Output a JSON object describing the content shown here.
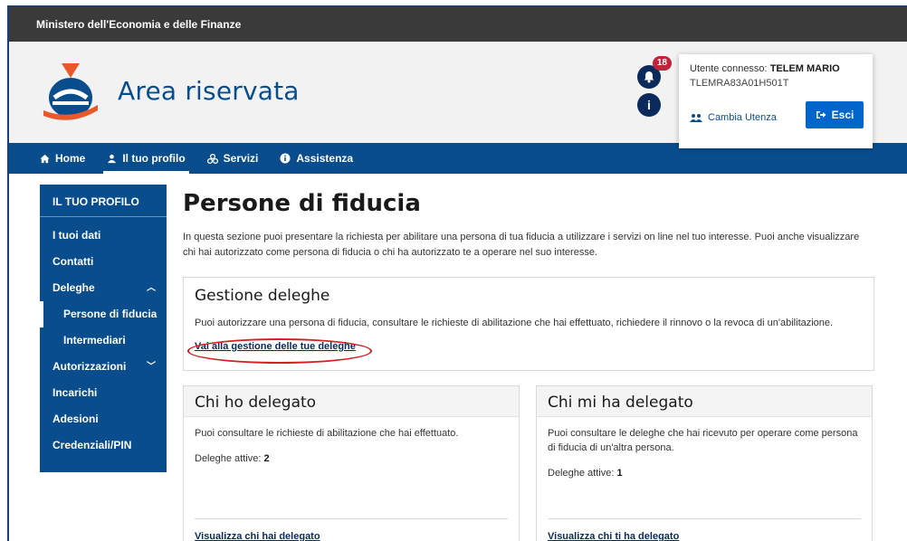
{
  "topbar": {
    "ministry": "Ministero dell'Economia e delle Finanze"
  },
  "header": {
    "title": "Area riservata",
    "notifications_count": "18",
    "user_label": "Utente connesso:",
    "user_name": "TELEM MARIO",
    "user_cf": "TLEMRA83A01H501T",
    "switch_user": "Cambia Utenza",
    "logout": "Esci"
  },
  "nav": {
    "items": [
      {
        "label": "Home",
        "icon": "home-icon"
      },
      {
        "label": "Il tuo profilo",
        "icon": "user-icon"
      },
      {
        "label": "Servizi",
        "icon": "services-icon"
      },
      {
        "label": "Assistenza",
        "icon": "info-icon"
      }
    ]
  },
  "sidebar": {
    "heading": "IL TUO PROFILO",
    "items": {
      "tuoi_dati": "I tuoi dati",
      "contatti": "Contatti",
      "deleghe": "Deleghe",
      "persone_fiducia": "Persone di fiducia",
      "intermediari": "Intermediari",
      "autorizzazioni": "Autorizzazioni",
      "incarichi": "Incarichi",
      "adesioni": "Adesioni",
      "credenziali": "Credenziali/PIN"
    }
  },
  "main": {
    "title": "Persone di fiducia",
    "intro": "In questa sezione puoi presentare la richiesta per abilitare una persona di tua fiducia a utilizzare i servizi on line nel tuo interesse. Puoi anche visualizzare chi hai autorizzato come persona di fiducia o chi ha autorizzato te a operare nel suo interesse.",
    "gestione": {
      "title": "Gestione deleghe",
      "text": "Puoi autorizzare una persona di fiducia, consultare le richieste di abilitazione che hai effettuato, richiedere il rinnovo o la revoca di un'abilitazione.",
      "link": "Vai alla gestione delle tue deleghe"
    },
    "chi_ho_delegato": {
      "title": "Chi ho delegato",
      "text": "Puoi consultare le richieste di abilitazione che hai effettuato.",
      "active_label": "Deleghe attive:",
      "active_value": "2",
      "link": "Visualizza chi hai delegato"
    },
    "chi_mi_ha_delegato": {
      "title": "Chi mi ha delegato",
      "text": "Puoi consultare le deleghe che hai ricevuto per operare come persona di fiducia di un'altra persona.",
      "active_label": "Deleghe attive:",
      "active_value": "1",
      "link": "Visualizza chi ti ha delegato"
    }
  },
  "colors": {
    "brand_blue": "#0a4d8c",
    "dark_bar": "#3a3a3a",
    "button_blue": "#0066cc",
    "badge_red": "#c0243a",
    "annotation_red": "#d42020"
  }
}
